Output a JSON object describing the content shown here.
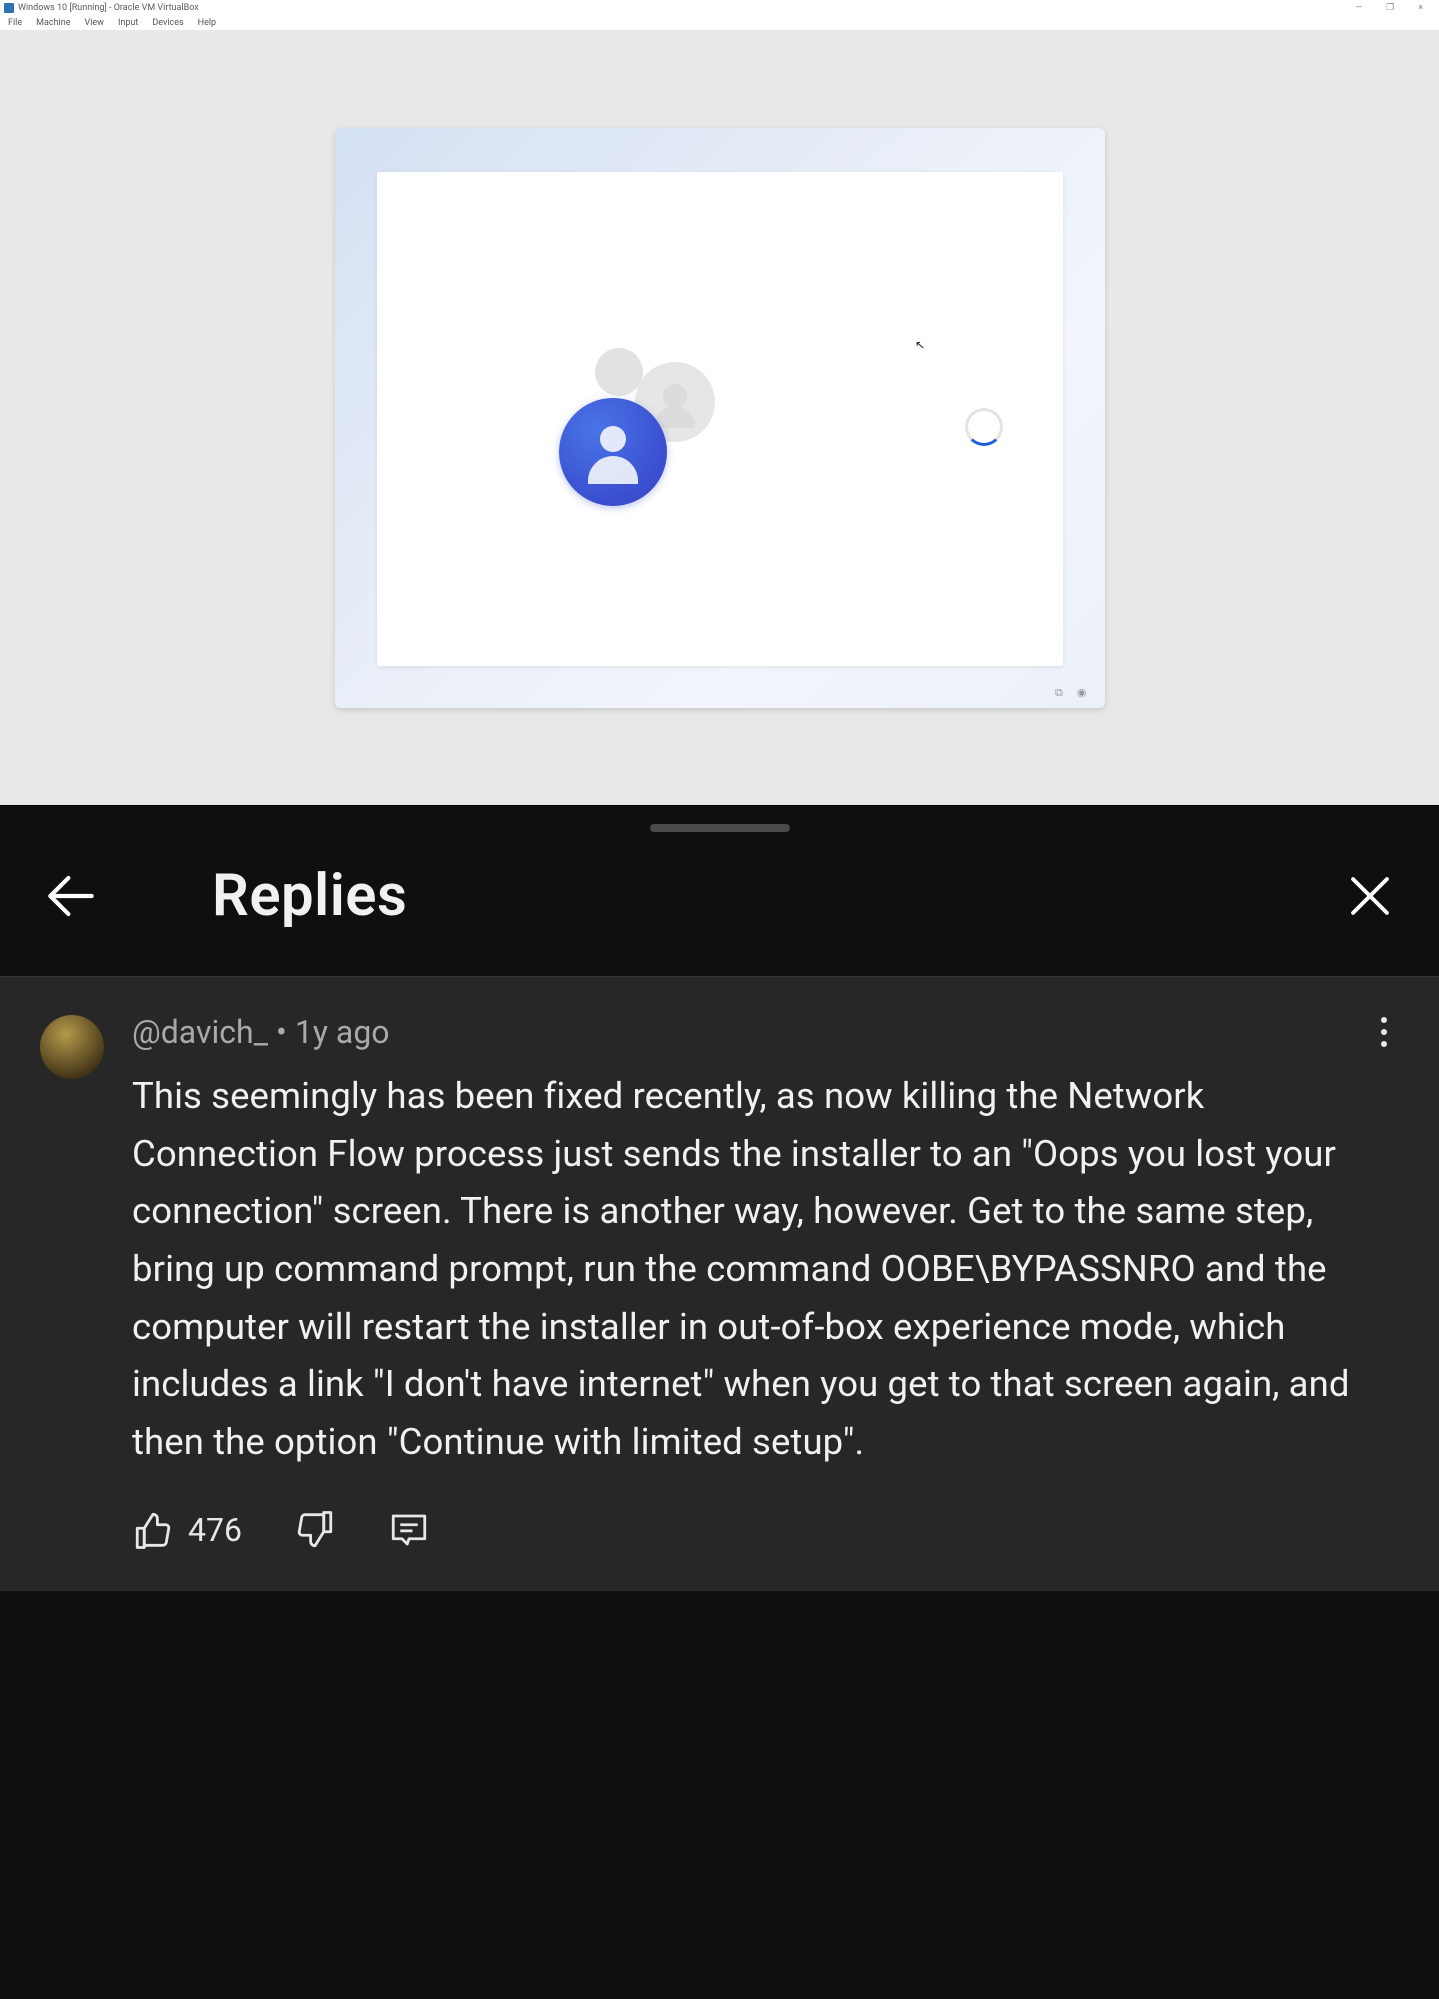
{
  "virtualbox": {
    "title": "Windows 10 [Running] - Oracle VM VirtualBox",
    "menus": [
      "File",
      "Machine",
      "View",
      "Input",
      "Devices",
      "Help"
    ],
    "window_controls": {
      "minimize": "—",
      "maximize": "❐",
      "close": "×"
    },
    "tray": {
      "snap": "⧉",
      "rec": "◉"
    }
  },
  "drawer": {
    "title": "Replies"
  },
  "comment": {
    "author": "@davich_",
    "separator": "•",
    "timestamp": "1y ago",
    "text": "This seemingly has been fixed recently, as now killing the Network Connection Flow process just sends the installer to an \"Oops you lost your connection\" screen. There is another way, however. Get to the same step, bring up command prompt, run the command OOBE\\BYPASSNRO and the computer will restart the installer in out-of-box experience mode, which includes a link \"I don't have internet\" when you get to that screen again, and then the option \"Continue with limited setup\".",
    "likes": "476"
  },
  "icons": {
    "user_silhouette": "user-icon",
    "spinner": "loading-spinner-icon"
  }
}
